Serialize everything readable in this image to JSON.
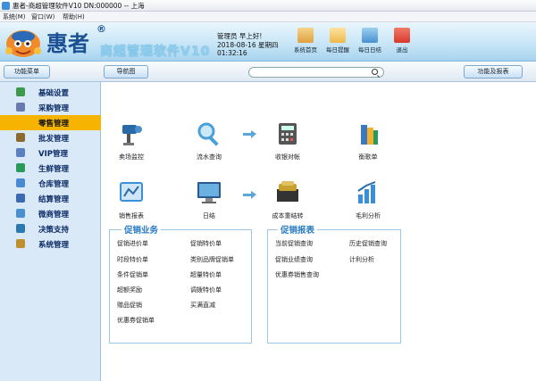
{
  "window": {
    "title": "惠者-商超管理软件V10 DN:000000 -- 上海"
  },
  "menu": [
    {
      "label": "系统(M)"
    },
    {
      "label": "窗口(W)"
    },
    {
      "label": "帮助(H)"
    }
  ],
  "header": {
    "logo_name": "惠者",
    "logo_mark": "®",
    "product_name": "商超管理软件V10",
    "user_greeting": "管理员 早上好!",
    "date": "2018-08-16 星期四",
    "time": "01:32:16",
    "buttons": [
      {
        "label": "系统首页",
        "icon": "house-icon",
        "color": "#e0a040"
      },
      {
        "label": "每日提醒",
        "icon": "note-icon",
        "color": "#f0b84a"
      },
      {
        "label": "每日日结",
        "icon": "bar-chart-icon",
        "color": "#4a90d0"
      },
      {
        "label": "退出",
        "icon": "power-icon",
        "color": "#d83a2a"
      }
    ]
  },
  "toolbar": {
    "menu_button": "功能菜单",
    "nav_button": "导航图",
    "report_button": "功能及报表"
  },
  "sidebar": {
    "items": [
      {
        "label": "基础设置",
        "icon": "settings-icon",
        "color": "#3c9a4a"
      },
      {
        "label": "采购管理",
        "icon": "cart-icon",
        "color": "#6a7ab0"
      },
      {
        "label": "零售管理",
        "icon": "retail-icon",
        "color": "#f6b400"
      },
      {
        "label": "批发管理",
        "icon": "wholesale-icon",
        "color": "#8a6a30"
      },
      {
        "label": "VIP管理",
        "icon": "vip-icon",
        "color": "#5a80c0"
      },
      {
        "label": "生鲜管理",
        "icon": "flask-icon",
        "color": "#2a9a5a"
      },
      {
        "label": "仓库管理",
        "icon": "warehouse-icon",
        "color": "#4a8ad0"
      },
      {
        "label": "结算管理",
        "icon": "settlement-icon",
        "color": "#3a6ab0"
      },
      {
        "label": "微商管理",
        "icon": "monitor-icon",
        "color": "#4a90d0"
      },
      {
        "label": "决策支持",
        "icon": "decision-icon",
        "color": "#2a7ab0"
      },
      {
        "label": "系统管理",
        "icon": "wrench-icon",
        "color": "#c09030"
      }
    ],
    "active_index": 2
  },
  "flow": {
    "icons": [
      {
        "label": "卖场监控",
        "icon": "camera-icon",
        "color": "#2a6aa8"
      },
      {
        "label": "流水查询",
        "icon": "magnifier-icon",
        "color": "#4aa0d8"
      },
      {
        "label": "收银对帐",
        "icon": "calculator-icon",
        "color": "#555"
      },
      {
        "label": "衡歌单",
        "icon": "books-icon",
        "color": "#3a78c0"
      },
      {
        "label": "销售报表",
        "icon": "chart-window-icon",
        "color": "#3a90d8"
      },
      {
        "label": "日结",
        "icon": "monitor-icon",
        "color": "#2a5a90"
      },
      {
        "label": "成本重结转",
        "icon": "coin-box-icon",
        "color": "#c8a030"
      },
      {
        "label": "毛利分析",
        "icon": "bar-chart-icon",
        "color": "#3a90d8"
      }
    ]
  },
  "promo_business": {
    "title": "促销业务",
    "links": [
      "促销进价单",
      "促销特价单",
      "时段特价单",
      "类别品牌促销单",
      "条件促销单",
      "超量特价单",
      "超额奖励",
      "调拨特价单",
      "赠品促销",
      "买满直减",
      "优惠券促销单"
    ]
  },
  "promo_report": {
    "title": "促销报表",
    "links": [
      "当前促销查询",
      "历史促销查询",
      "促销业绩查询",
      "计利分析",
      "优惠券销售查询"
    ]
  }
}
